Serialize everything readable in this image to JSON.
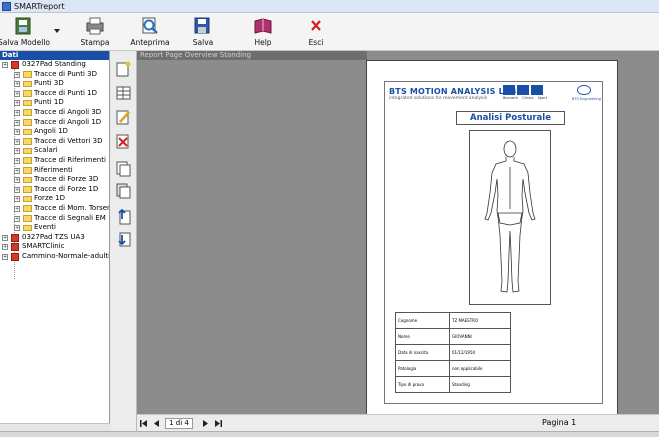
{
  "window": {
    "title": "SMARTreport"
  },
  "toolbar": {
    "buttons": [
      {
        "label": "Salva Modello",
        "icon": "save-template-icon"
      },
      {
        "label": "Stampa",
        "icon": "printer-icon"
      },
      {
        "label": "Anteprima",
        "icon": "preview-icon"
      },
      {
        "label": "Salva",
        "icon": "save-icon"
      },
      {
        "label": "Help",
        "icon": "help-book-icon"
      },
      {
        "label": "Esci",
        "icon": "close-icon"
      }
    ]
  },
  "tree": {
    "header": "Dati",
    "items": [
      {
        "label": "0327Pad Standing",
        "level": 0,
        "type": "root"
      },
      {
        "label": "Tracce di Punti 3D",
        "level": 1,
        "type": "folder"
      },
      {
        "label": "Punti 3D",
        "level": 1,
        "type": "folder"
      },
      {
        "label": "Tracce di Punti 1D",
        "level": 1,
        "type": "folder"
      },
      {
        "label": "Punti 1D",
        "level": 1,
        "type": "folder"
      },
      {
        "label": "Tracce di Angoli 3D",
        "level": 1,
        "type": "folder"
      },
      {
        "label": "Tracce di Angoli 1D",
        "level": 1,
        "type": "folder"
      },
      {
        "label": "Angoli 1D",
        "level": 1,
        "type": "folder"
      },
      {
        "label": "Tracce di Vettori 3D",
        "level": 1,
        "type": "folder"
      },
      {
        "label": "Scalari",
        "level": 1,
        "type": "folder"
      },
      {
        "label": "Tracce di Riferimenti",
        "level": 1,
        "type": "folder"
      },
      {
        "label": "Riferimenti",
        "level": 1,
        "type": "folder"
      },
      {
        "label": "Tracce di Forze 3D",
        "level": 1,
        "type": "folder"
      },
      {
        "label": "Tracce di Forze 1D",
        "level": 1,
        "type": "folder"
      },
      {
        "label": "Forze 1D",
        "level": 1,
        "type": "folder"
      },
      {
        "label": "Tracce di Mom. Torsen",
        "level": 1,
        "type": "folder"
      },
      {
        "label": "Tracce di Segnali EM",
        "level": 1,
        "type": "folder"
      },
      {
        "label": "Eventi",
        "level": 1,
        "type": "folder"
      },
      {
        "label": "0327Pad TZS UA3",
        "level": 0,
        "type": "root"
      },
      {
        "label": "SMARTClinic",
        "level": 0,
        "type": "root"
      },
      {
        "label": "Cammino-Normale-adulti",
        "level": 0,
        "type": "root"
      }
    ]
  },
  "preview": {
    "header": "Report Page Overview Standing",
    "report": {
      "lab_title": "BTS MOTION ANALYSIS LAB",
      "lab_subtitle": "integrated solutions for movement analysis",
      "lab_icon_labels": [
        "Biomech",
        "Clinics",
        "Sport"
      ],
      "bts_logo": "BTS Engineering",
      "title": "Analisi Posturale",
      "info_rows": [
        {
          "key": "Cognome",
          "value": "TZ MAESTRO"
        },
        {
          "key": "Nome",
          "value": "GIOVANNI"
        },
        {
          "key": "Data di nascita",
          "value": "01/12/1950"
        },
        {
          "key": "Patologia",
          "value": "non applicabile"
        },
        {
          "key": "Tipo di prova",
          "value": "Standing"
        }
      ]
    }
  },
  "navbar": {
    "page_box": "1 di 4",
    "page_label": "Pagina 1"
  },
  "colors": {
    "accent": "#1a4fa8",
    "folder": "#f7d66a",
    "preview_bg": "#8c8c8c"
  }
}
